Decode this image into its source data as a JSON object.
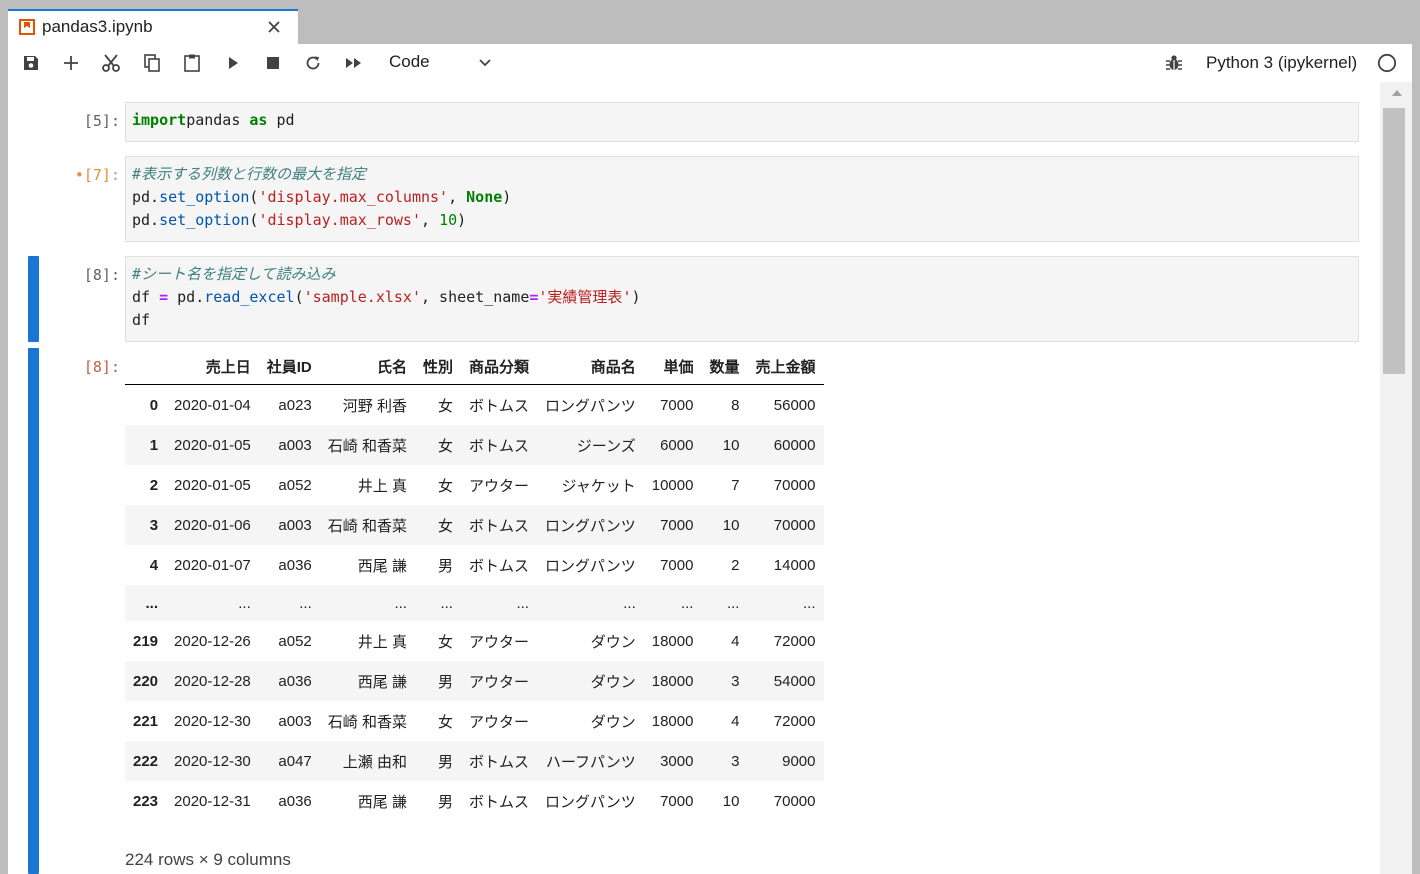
{
  "tab": {
    "title": "pandas3.ipynb"
  },
  "toolbar": {
    "cell_type": "Code",
    "kernel_name": "Python 3 (ipykernel)"
  },
  "cells": [
    {
      "prompt": "[5]:",
      "lines": [
        [
          [
            "kw",
            "import"
          ],
          [
            "",
            "pandas "
          ],
          [
            "kw",
            "as"
          ],
          [
            "",
            " pd"
          ]
        ]
      ]
    },
    {
      "prompt": "•[7]:",
      "lines": [
        [
          [
            "cm",
            "#表示する列数と行数の最大を指定"
          ]
        ],
        [
          [
            "",
            "pd."
          ],
          [
            "fn",
            "set_option"
          ],
          [
            "",
            "("
          ],
          [
            "st",
            "'display.max_columns'"
          ],
          [
            "",
            ", "
          ],
          [
            "kw",
            "None"
          ],
          [
            "",
            ")"
          ]
        ],
        [
          [
            "",
            "pd."
          ],
          [
            "fn",
            "set_option"
          ],
          [
            "",
            "("
          ],
          [
            "st",
            "'display.max_rows'"
          ],
          [
            "",
            ", "
          ],
          [
            "nm",
            "10"
          ],
          [
            "",
            ")"
          ]
        ]
      ]
    },
    {
      "prompt": "[8]:",
      "lines": [
        [
          [
            "cm",
            "#シート名を指定して読み込み"
          ]
        ],
        [
          [
            "",
            "df "
          ],
          [
            "op",
            "="
          ],
          [
            "",
            " pd."
          ],
          [
            "fn",
            "read_excel"
          ],
          [
            "",
            "("
          ],
          [
            "st",
            "'sample.xlsx'"
          ],
          [
            "",
            ", sheet_name"
          ],
          [
            "op",
            "="
          ],
          [
            "st",
            "'実績管理表'"
          ],
          [
            "",
            ")"
          ]
        ],
        [
          [
            "",
            "df"
          ]
        ]
      ]
    }
  ],
  "output": {
    "prompt": "[8]:",
    "columns": [
      "",
      "売上日",
      "社員ID",
      "氏名",
      "性別",
      "商品分類",
      "商品名",
      "単価",
      "数量",
      "売上金額"
    ],
    "rows": [
      [
        "0",
        "2020-01-04",
        "a023",
        "河野 利香",
        "女",
        "ボトムス",
        "ロングパンツ",
        "7000",
        "8",
        "56000"
      ],
      [
        "1",
        "2020-01-05",
        "a003",
        "石崎 和香菜",
        "女",
        "ボトムス",
        "ジーンズ",
        "6000",
        "10",
        "60000"
      ],
      [
        "2",
        "2020-01-05",
        "a052",
        "井上 真",
        "女",
        "アウター",
        "ジャケット",
        "10000",
        "7",
        "70000"
      ],
      [
        "3",
        "2020-01-06",
        "a003",
        "石崎 和香菜",
        "女",
        "ボトムス",
        "ロングパンツ",
        "7000",
        "10",
        "70000"
      ],
      [
        "4",
        "2020-01-07",
        "a036",
        "西尾 謙",
        "男",
        "ボトムス",
        "ロングパンツ",
        "7000",
        "2",
        "14000"
      ],
      [
        "...",
        "...",
        "...",
        "...",
        "...",
        "...",
        "...",
        "...",
        "...",
        "..."
      ],
      [
        "219",
        "2020-12-26",
        "a052",
        "井上 真",
        "女",
        "アウター",
        "ダウン",
        "18000",
        "4",
        "72000"
      ],
      [
        "220",
        "2020-12-28",
        "a036",
        "西尾 謙",
        "男",
        "アウター",
        "ダウン",
        "18000",
        "3",
        "54000"
      ],
      [
        "221",
        "2020-12-30",
        "a003",
        "石崎 和香菜",
        "女",
        "アウター",
        "ダウン",
        "18000",
        "4",
        "72000"
      ],
      [
        "222",
        "2020-12-30",
        "a047",
        "上瀬 由和",
        "男",
        "ボトムス",
        "ハーフパンツ",
        "3000",
        "3",
        "9000"
      ],
      [
        "223",
        "2020-12-31",
        "a036",
        "西尾 謙",
        "男",
        "ボトムス",
        "ロングパンツ",
        "7000",
        "10",
        "70000"
      ]
    ],
    "summary": "224 rows × 9 columns"
  },
  "colors": {
    "accent": "#1976d2",
    "string": "#ba2121",
    "keyword": "#008000",
    "comment": "#408080"
  }
}
